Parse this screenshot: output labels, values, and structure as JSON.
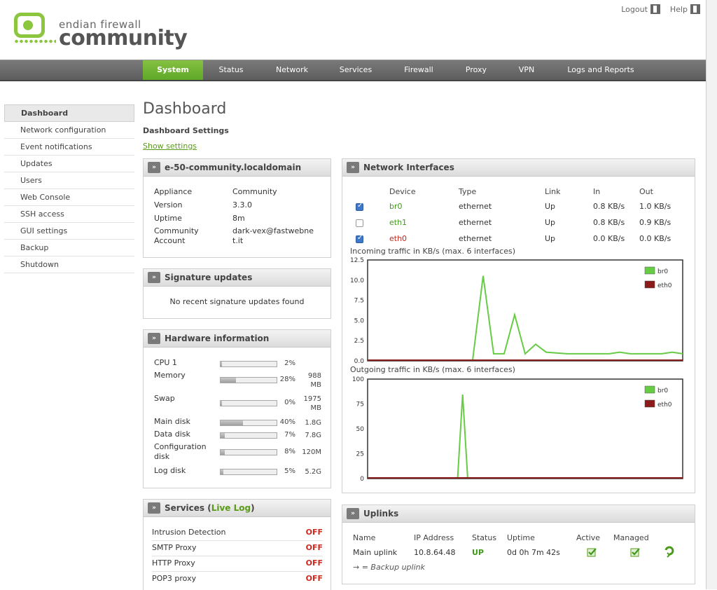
{
  "header": {
    "logout_label": "Logout",
    "help_label": "Help",
    "logo_line1": "endian firewall",
    "logo_line2": "community"
  },
  "nav": [
    {
      "label": "System",
      "active": true
    },
    {
      "label": "Status"
    },
    {
      "label": "Network"
    },
    {
      "label": "Services"
    },
    {
      "label": "Firewall"
    },
    {
      "label": "Proxy"
    },
    {
      "label": "VPN"
    },
    {
      "label": "Logs and Reports"
    }
  ],
  "sidebar": [
    {
      "label": "Dashboard",
      "active": true
    },
    {
      "label": "Network configuration"
    },
    {
      "label": "Event notifications"
    },
    {
      "label": "Updates"
    },
    {
      "label": "Users"
    },
    {
      "label": "Web Console"
    },
    {
      "label": "SSH access"
    },
    {
      "label": "GUI settings"
    },
    {
      "label": "Backup"
    },
    {
      "label": "Shutdown"
    }
  ],
  "page": {
    "title": "Dashboard",
    "settings_heading": "Dashboard Settings",
    "show_settings": "Show settings"
  },
  "appliance": {
    "title": "e-50-community.localdomain",
    "rows": [
      {
        "key": "Appliance",
        "value": "Community"
      },
      {
        "key": "Version",
        "value": "3.3.0"
      },
      {
        "key": "Uptime",
        "value": "8m"
      },
      {
        "key": "Community Account",
        "value": "dark-vex@fastwebnet.it"
      }
    ]
  },
  "signature": {
    "title": "Signature updates",
    "message": "No recent signature updates found"
  },
  "hardware": {
    "title": "Hardware information",
    "rows": [
      {
        "label": "CPU 1",
        "percent": 2,
        "pct_label": "2%",
        "size": ""
      },
      {
        "label": "Memory",
        "percent": 28,
        "pct_label": "28%",
        "size": "988 MB"
      },
      {
        "label": "Swap",
        "percent": 0,
        "pct_label": "0%",
        "size": "1975 MB"
      },
      {
        "label": "Main disk",
        "percent": 40,
        "pct_label": "40%",
        "size": "1.8G"
      },
      {
        "label": "Data disk",
        "percent": 7,
        "pct_label": "7%",
        "size": "7.8G"
      },
      {
        "label": "Configuration disk",
        "percent": 8,
        "pct_label": "8%",
        "size": "120M"
      },
      {
        "label": "Log disk",
        "percent": 5,
        "pct_label": "5%",
        "size": "5.2G"
      }
    ]
  },
  "services": {
    "title_prefix": "Services (",
    "title_link": "Live Log",
    "title_suffix": ")",
    "rows": [
      {
        "label": "Intrusion Detection",
        "status": "OFF"
      },
      {
        "label": "SMTP Proxy",
        "status": "OFF"
      },
      {
        "label": "HTTP Proxy",
        "status": "OFF"
      },
      {
        "label": "POP3 proxy",
        "status": "OFF"
      }
    ]
  },
  "network": {
    "title": "Network Interfaces",
    "headers": [
      "Device",
      "Type",
      "Link",
      "In",
      "Out"
    ],
    "rows": [
      {
        "checked": true,
        "device": "br0",
        "color": "#3f9a1a",
        "type": "ethernet",
        "link": "Up",
        "in": "0.8 KB/s",
        "out": "1.0 KB/s"
      },
      {
        "checked": false,
        "device": "eth1",
        "color": "#3f9a1a",
        "type": "ethernet",
        "link": "Up",
        "in": "0.8 KB/s",
        "out": "0.9 KB/s"
      },
      {
        "checked": true,
        "device": "eth0",
        "color": "#c0281f",
        "type": "ethernet",
        "link": "Up",
        "in": "0.0 KB/s",
        "out": "0.0 KB/s"
      }
    ]
  },
  "chart_data": [
    {
      "type": "line",
      "title": "Incoming traffic in KB/s (max. 6 interfaces)",
      "ylim": [
        0,
        12.5
      ],
      "yticks": [
        "12.5",
        "10.0",
        "7.5",
        "5.0",
        "2.5",
        "0.0"
      ],
      "series": [
        {
          "name": "br0",
          "color": "#66cc44",
          "values": [
            0,
            0,
            0,
            0,
            0,
            0,
            0,
            0,
            0,
            0,
            0,
            10.6,
            0.8,
            0.8,
            5.7,
            0.8,
            2.0,
            1.0,
            0.9,
            0.8,
            0.8,
            0.8,
            0.8,
            0.8,
            1.0,
            0.8,
            0.8,
            0.8,
            0.8,
            1.0,
            0.8
          ]
        },
        {
          "name": "eth0",
          "color": "#8b1a1a",
          "values": [
            0,
            0,
            0,
            0,
            0,
            0,
            0,
            0,
            0,
            0,
            0,
            0,
            0,
            0,
            0,
            0,
            0,
            0,
            0,
            0,
            0,
            0,
            0,
            0,
            0,
            0,
            0,
            0,
            0,
            0,
            0
          ]
        }
      ]
    },
    {
      "type": "line",
      "title": "Outgoing traffic in KB/s (max. 6 interfaces)",
      "ylim": [
        0,
        100
      ],
      "yticks": [
        "100",
        "75",
        "50",
        "25",
        "0"
      ],
      "series": [
        {
          "name": "br0",
          "color": "#66cc44",
          "values": [
            0,
            0,
            0,
            0,
            0,
            0,
            0,
            0,
            0,
            0,
            0,
            0,
            0,
            0,
            0,
            0,
            0,
            0,
            0,
            85,
            0,
            0,
            0,
            0,
            0,
            0,
            0,
            0,
            0,
            0,
            0,
            0,
            0,
            0,
            0,
            0,
            0,
            0,
            0,
            0,
            0,
            0,
            0,
            0,
            0,
            0,
            0,
            0,
            0,
            0,
            0,
            0,
            0,
            0,
            0,
            0,
            0,
            0,
            0,
            0,
            0,
            0,
            0,
            0
          ]
        },
        {
          "name": "eth0",
          "color": "#8b1a1a",
          "values": [
            0,
            0,
            0,
            0,
            0,
            0,
            0,
            0,
            0,
            0,
            0,
            0,
            0,
            0,
            0,
            0,
            0,
            0,
            0,
            0,
            0,
            0,
            0,
            0,
            0,
            0,
            0,
            0,
            0,
            0,
            0,
            0,
            0,
            0,
            0,
            0,
            0,
            0,
            0,
            0,
            0,
            0,
            0,
            0,
            0,
            0,
            0,
            0,
            0,
            0,
            0,
            0,
            0,
            0,
            0,
            0,
            0,
            0,
            0,
            0,
            0,
            0,
            0,
            0
          ]
        }
      ]
    }
  ],
  "uplinks": {
    "title": "Uplinks",
    "headers": [
      "Name",
      "IP Address",
      "Status",
      "Uptime",
      "Active",
      "Managed"
    ],
    "rows": [
      {
        "name": "Main uplink",
        "ip": "10.8.64.48",
        "status": "UP",
        "uptime": "0d 0h 7m 42s"
      }
    ],
    "footnote": "→ = Backup uplink"
  }
}
